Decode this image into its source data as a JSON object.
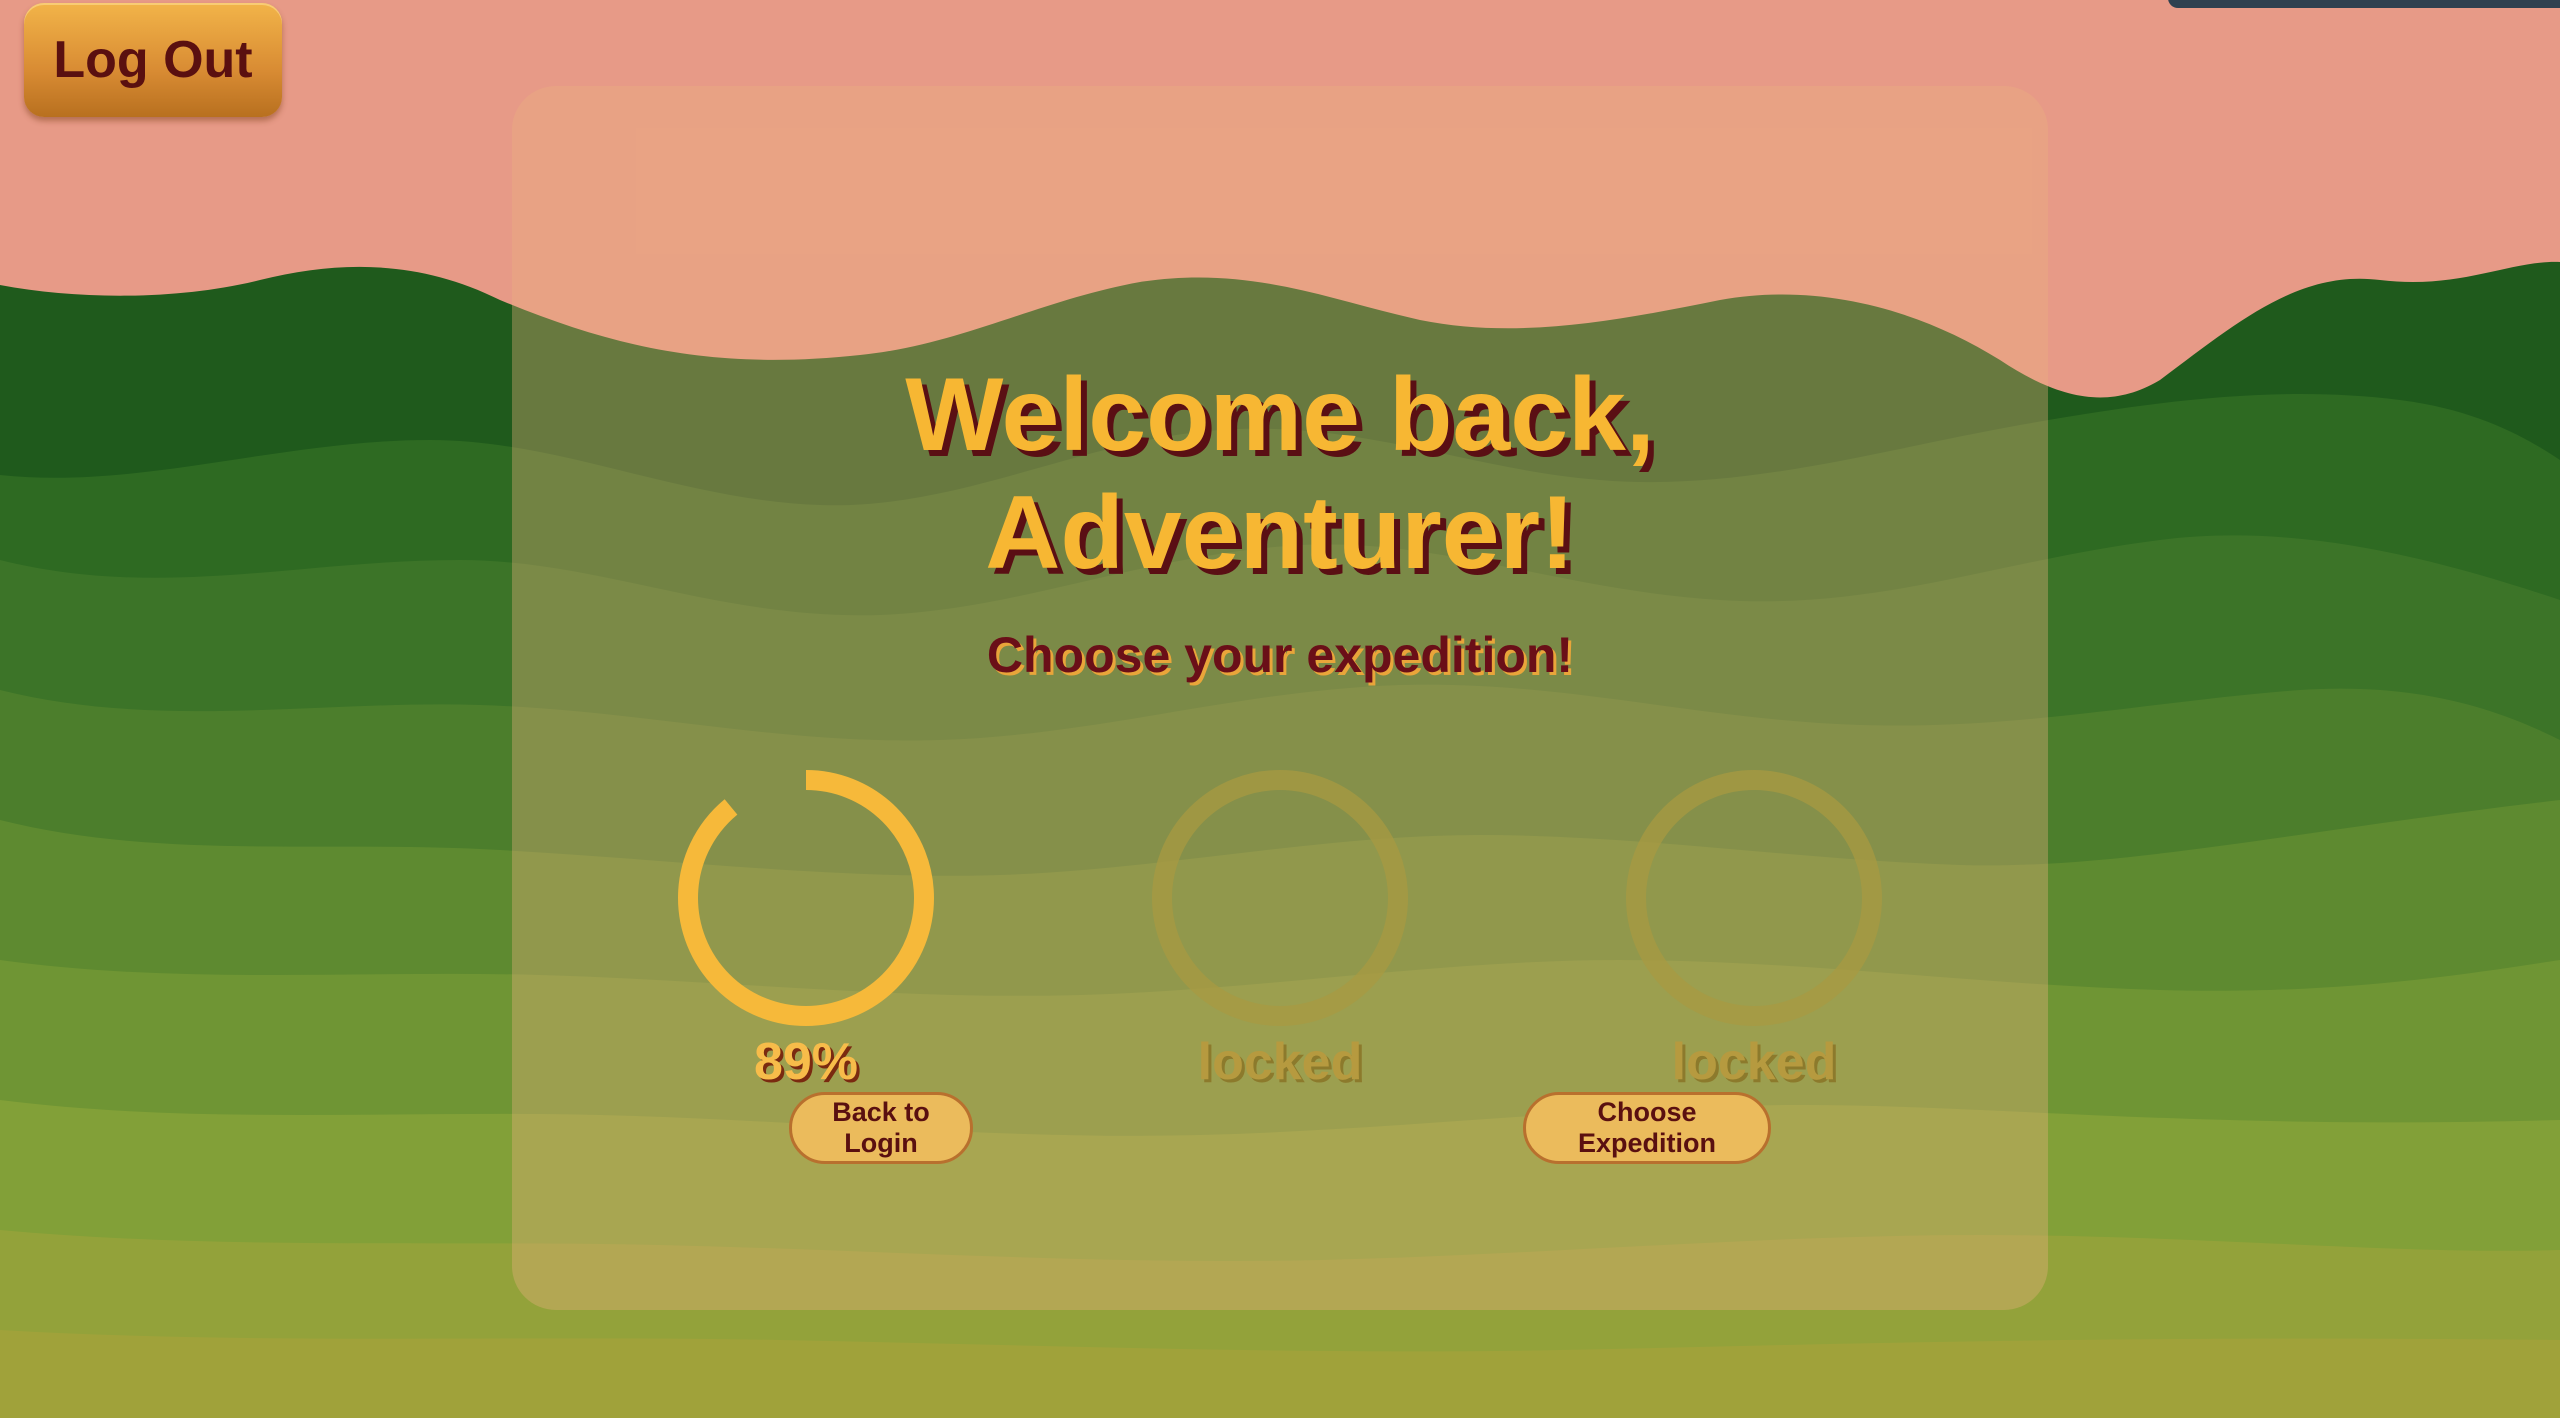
{
  "header": {
    "logout_label": "Log Out"
  },
  "welcome": {
    "title_line1": "Welcome back,",
    "title_line2": "Adventurer!",
    "subtitle": "Choose your expedition!"
  },
  "expeditions": [
    {
      "label": "89%",
      "status": "active",
      "progress": 0.89
    },
    {
      "label": "locked",
      "status": "locked",
      "progress": 0
    },
    {
      "label": "locked",
      "status": "locked",
      "progress": 0
    }
  ],
  "buttons": {
    "back_to_login": "Back to Login",
    "choose_expedition": "Choose Expedition"
  },
  "colors": {
    "sky": "#E79A87",
    "accent_gold": "#F7B733",
    "dark_red": "#5A0F14",
    "ring_active": "#F6B93A",
    "ring_locked": "#A89A42"
  }
}
